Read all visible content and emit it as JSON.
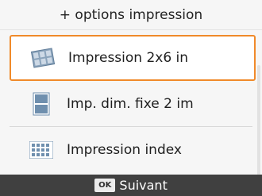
{
  "header": {
    "title": "+ options impression"
  },
  "menu": {
    "items": [
      {
        "label": "Impression 2x6 in",
        "icon": "photo-strip-icon",
        "selected": true
      },
      {
        "label": "Imp. dim. fixe 2 im",
        "icon": "two-image-fixed-size-icon",
        "selected": false
      },
      {
        "label": "Impression index",
        "icon": "index-grid-icon",
        "selected": false
      }
    ]
  },
  "footer": {
    "ok_label": "OK",
    "next_label": "Suivant"
  },
  "colors": {
    "selection_border": "#f08a2a",
    "footer_background": "#404040",
    "icon_blue": "#6f8fae"
  }
}
